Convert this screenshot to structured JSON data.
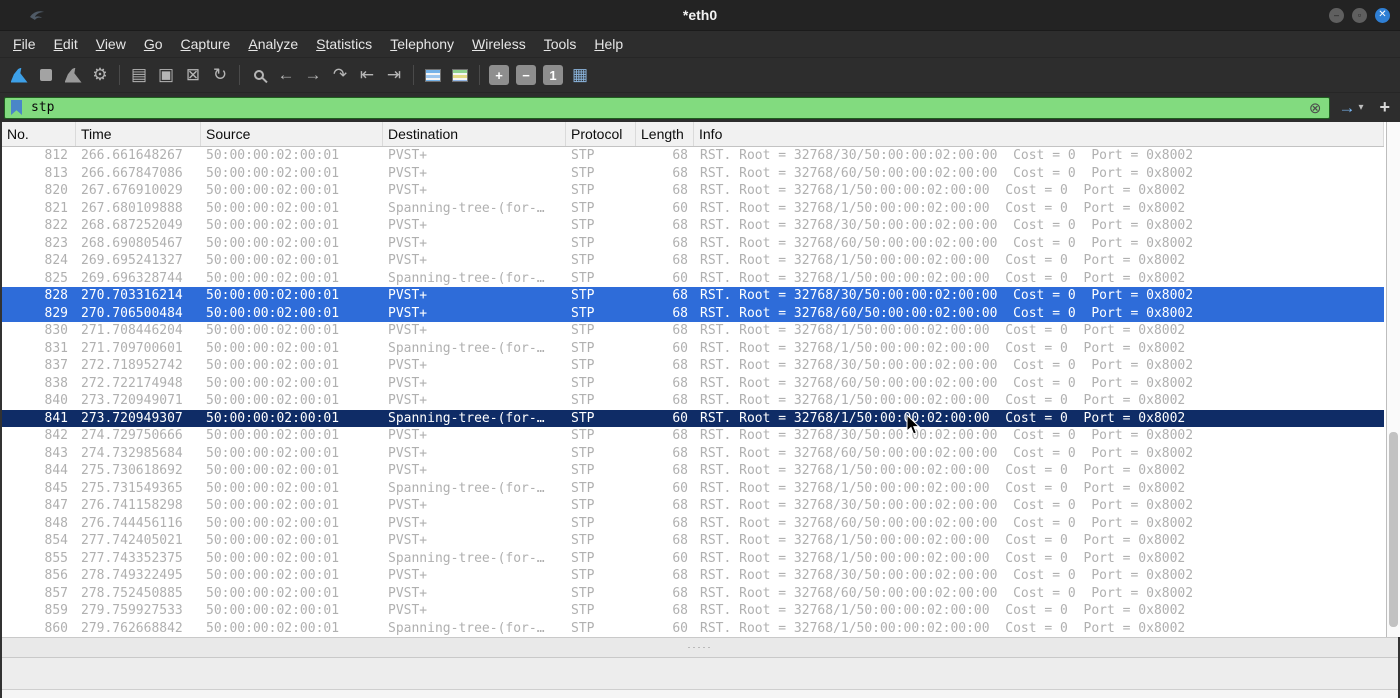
{
  "window": {
    "title": "*eth0",
    "controls": {
      "minimize": "–",
      "maximize": "▫",
      "close": "✕"
    }
  },
  "menu": {
    "items": [
      "File",
      "Edit",
      "View",
      "Go",
      "Capture",
      "Analyze",
      "Statistics",
      "Telephony",
      "Wireless",
      "Tools",
      "Help"
    ]
  },
  "toolbar": {
    "groups": [
      [
        {
          "name": "start-capture-icon",
          "shape": "fin",
          "color": "#3da0e8"
        },
        {
          "name": "stop-capture-icon",
          "shape": "square",
          "color": "#a3a3a3"
        },
        {
          "name": "restart-capture-icon",
          "shape": "fin",
          "color": "#9a9a9a"
        },
        {
          "name": "capture-options-icon",
          "glyph": "⚙"
        }
      ],
      [
        {
          "name": "open-file-icon",
          "glyph": "▤"
        },
        {
          "name": "save-file-icon",
          "glyph": "▣"
        },
        {
          "name": "close-file-icon",
          "glyph": "⊠"
        },
        {
          "name": "reload-file-icon",
          "glyph": "↻"
        }
      ],
      [
        {
          "name": "find-packet-icon",
          "shape": "search"
        },
        {
          "name": "go-back-icon",
          "glyph": "←"
        },
        {
          "name": "go-forward-icon",
          "glyph": "→"
        },
        {
          "name": "go-to-packet-icon",
          "glyph": "↷"
        },
        {
          "name": "go-first-icon",
          "glyph": "⇤"
        },
        {
          "name": "go-last-icon",
          "glyph": "⇥"
        }
      ],
      [
        {
          "name": "auto-scroll-icon",
          "shape": "stripes-blue"
        },
        {
          "name": "colorize-icon",
          "shape": "stripes-color"
        }
      ],
      [
        {
          "name": "zoom-in-icon",
          "glyph": "+",
          "box": true
        },
        {
          "name": "zoom-out-icon",
          "glyph": "−",
          "box": true
        },
        {
          "name": "zoom-original-icon",
          "glyph": "1",
          "box": true
        },
        {
          "name": "resize-columns-icon",
          "glyph": "▦",
          "color": "#8ab4dc"
        }
      ]
    ]
  },
  "filter": {
    "value": "stp",
    "clear_glyph": "⊗",
    "apply_glyph": "→",
    "dropdown_glyph": "▾",
    "add_button": "+"
  },
  "splitter_dots": "·····",
  "packet_list": {
    "columns": [
      "No.",
      "Time",
      "Source",
      "Destination",
      "Protocol",
      "Length",
      "Info"
    ],
    "rows": [
      {
        "no": "812",
        "time": "266.661648267",
        "src": "50:00:00:02:00:01",
        "dst": "PVST+",
        "proto": "STP",
        "len": "68",
        "info": "RST. Root = 32768/30/50:00:00:02:00:00  Cost = 0  Port = 0x8002",
        "state": "normal"
      },
      {
        "no": "813",
        "time": "266.667847086",
        "src": "50:00:00:02:00:01",
        "dst": "PVST+",
        "proto": "STP",
        "len": "68",
        "info": "RST. Root = 32768/60/50:00:00:02:00:00  Cost = 0  Port = 0x8002",
        "state": "normal"
      },
      {
        "no": "820",
        "time": "267.676910029",
        "src": "50:00:00:02:00:01",
        "dst": "PVST+",
        "proto": "STP",
        "len": "68",
        "info": "RST. Root = 32768/1/50:00:00:02:00:00  Cost = 0  Port = 0x8002",
        "state": "normal"
      },
      {
        "no": "821",
        "time": "267.680109888",
        "src": "50:00:00:02:00:01",
        "dst": "Spanning-tree-(for-…",
        "proto": "STP",
        "len": "60",
        "info": "RST. Root = 32768/1/50:00:00:02:00:00  Cost = 0  Port = 0x8002",
        "state": "normal"
      },
      {
        "no": "822",
        "time": "268.687252049",
        "src": "50:00:00:02:00:01",
        "dst": "PVST+",
        "proto": "STP",
        "len": "68",
        "info": "RST. Root = 32768/30/50:00:00:02:00:00  Cost = 0  Port = 0x8002",
        "state": "normal"
      },
      {
        "no": "823",
        "time": "268.690805467",
        "src": "50:00:00:02:00:01",
        "dst": "PVST+",
        "proto": "STP",
        "len": "68",
        "info": "RST. Root = 32768/60/50:00:00:02:00:00  Cost = 0  Port = 0x8002",
        "state": "normal"
      },
      {
        "no": "824",
        "time": "269.695241327",
        "src": "50:00:00:02:00:01",
        "dst": "PVST+",
        "proto": "STP",
        "len": "68",
        "info": "RST. Root = 32768/1/50:00:00:02:00:00  Cost = 0  Port = 0x8002",
        "state": "normal"
      },
      {
        "no": "825",
        "time": "269.696328744",
        "src": "50:00:00:02:00:01",
        "dst": "Spanning-tree-(for-…",
        "proto": "STP",
        "len": "60",
        "info": "RST. Root = 32768/1/50:00:00:02:00:00  Cost = 0  Port = 0x8002",
        "state": "normal"
      },
      {
        "no": "828",
        "time": "270.703316214",
        "src": "50:00:00:02:00:01",
        "dst": "PVST+",
        "proto": "STP",
        "len": "68",
        "info": "RST. Root = 32768/30/50:00:00:02:00:00  Cost = 0  Port = 0x8002",
        "state": "selected"
      },
      {
        "no": "829",
        "time": "270.706500484",
        "src": "50:00:00:02:00:01",
        "dst": "PVST+",
        "proto": "STP",
        "len": "68",
        "info": "RST. Root = 32768/60/50:00:00:02:00:00  Cost = 0  Port = 0x8002",
        "state": "selected"
      },
      {
        "no": "830",
        "time": "271.708446204",
        "src": "50:00:00:02:00:01",
        "dst": "PVST+",
        "proto": "STP",
        "len": "68",
        "info": "RST. Root = 32768/1/50:00:00:02:00:00  Cost = 0  Port = 0x8002",
        "state": "normal"
      },
      {
        "no": "831",
        "time": "271.709700601",
        "src": "50:00:00:02:00:01",
        "dst": "Spanning-tree-(for-…",
        "proto": "STP",
        "len": "60",
        "info": "RST. Root = 32768/1/50:00:00:02:00:00  Cost = 0  Port = 0x8002",
        "state": "normal"
      },
      {
        "no": "837",
        "time": "272.718952742",
        "src": "50:00:00:02:00:01",
        "dst": "PVST+",
        "proto": "STP",
        "len": "68",
        "info": "RST. Root = 32768/30/50:00:00:02:00:00  Cost = 0  Port = 0x8002",
        "state": "normal"
      },
      {
        "no": "838",
        "time": "272.722174948",
        "src": "50:00:00:02:00:01",
        "dst": "PVST+",
        "proto": "STP",
        "len": "68",
        "info": "RST. Root = 32768/60/50:00:00:02:00:00  Cost = 0  Port = 0x8002",
        "state": "normal"
      },
      {
        "no": "840",
        "time": "273.720949071",
        "src": "50:00:00:02:00:01",
        "dst": "PVST+",
        "proto": "STP",
        "len": "68",
        "info": "RST. Root = 32768/1/50:00:00:02:00:00  Cost = 0  Port = 0x8002",
        "state": "normal"
      },
      {
        "no": "841",
        "time": "273.720949307",
        "src": "50:00:00:02:00:01",
        "dst": "Spanning-tree-(for-…",
        "proto": "STP",
        "len": "60",
        "info": "RST. Root = 32768/1/50:00:00:02:00:00  Cost = 0  Port = 0x8002",
        "state": "marked"
      },
      {
        "no": "842",
        "time": "274.729750666",
        "src": "50:00:00:02:00:01",
        "dst": "PVST+",
        "proto": "STP",
        "len": "68",
        "info": "RST. Root = 32768/30/50:00:00:02:00:00  Cost = 0  Port = 0x8002",
        "state": "normal"
      },
      {
        "no": "843",
        "time": "274.732985684",
        "src": "50:00:00:02:00:01",
        "dst": "PVST+",
        "proto": "STP",
        "len": "68",
        "info": "RST. Root = 32768/60/50:00:00:02:00:00  Cost = 0  Port = 0x8002",
        "state": "normal"
      },
      {
        "no": "844",
        "time": "275.730618692",
        "src": "50:00:00:02:00:01",
        "dst": "PVST+",
        "proto": "STP",
        "len": "68",
        "info": "RST. Root = 32768/1/50:00:00:02:00:00  Cost = 0  Port = 0x8002",
        "state": "normal"
      },
      {
        "no": "845",
        "time": "275.731549365",
        "src": "50:00:00:02:00:01",
        "dst": "Spanning-tree-(for-…",
        "proto": "STP",
        "len": "60",
        "info": "RST. Root = 32768/1/50:00:00:02:00:00  Cost = 0  Port = 0x8002",
        "state": "normal"
      },
      {
        "no": "847",
        "time": "276.741158298",
        "src": "50:00:00:02:00:01",
        "dst": "PVST+",
        "proto": "STP",
        "len": "68",
        "info": "RST. Root = 32768/30/50:00:00:02:00:00  Cost = 0  Port = 0x8002",
        "state": "normal"
      },
      {
        "no": "848",
        "time": "276.744456116",
        "src": "50:00:00:02:00:01",
        "dst": "PVST+",
        "proto": "STP",
        "len": "68",
        "info": "RST. Root = 32768/60/50:00:00:02:00:00  Cost = 0  Port = 0x8002",
        "state": "normal"
      },
      {
        "no": "854",
        "time": "277.742405021",
        "src": "50:00:00:02:00:01",
        "dst": "PVST+",
        "proto": "STP",
        "len": "68",
        "info": "RST. Root = 32768/1/50:00:00:02:00:00  Cost = 0  Port = 0x8002",
        "state": "normal"
      },
      {
        "no": "855",
        "time": "277.743352375",
        "src": "50:00:00:02:00:01",
        "dst": "Spanning-tree-(for-…",
        "proto": "STP",
        "len": "60",
        "info": "RST. Root = 32768/1/50:00:00:02:00:00  Cost = 0  Port = 0x8002",
        "state": "normal"
      },
      {
        "no": "856",
        "time": "278.749322495",
        "src": "50:00:00:02:00:01",
        "dst": "PVST+",
        "proto": "STP",
        "len": "68",
        "info": "RST. Root = 32768/30/50:00:00:02:00:00  Cost = 0  Port = 0x8002",
        "state": "normal"
      },
      {
        "no": "857",
        "time": "278.752450885",
        "src": "50:00:00:02:00:01",
        "dst": "PVST+",
        "proto": "STP",
        "len": "68",
        "info": "RST. Root = 32768/60/50:00:00:02:00:00  Cost = 0  Port = 0x8002",
        "state": "normal"
      },
      {
        "no": "859",
        "time": "279.759927533",
        "src": "50:00:00:02:00:01",
        "dst": "PVST+",
        "proto": "STP",
        "len": "68",
        "info": "RST. Root = 32768/1/50:00:00:02:00:00  Cost = 0  Port = 0x8002",
        "state": "normal"
      },
      {
        "no": "860",
        "time": "279.762668842",
        "src": "50:00:00:02:00:01",
        "dst": "Spanning-tree-(for-…",
        "proto": "STP",
        "len": "60",
        "info": "RST. Root = 32768/1/50:00:00:02:00:00  Cost = 0  Port = 0x8002",
        "state": "normal"
      }
    ]
  },
  "colors": {
    "titlebar_bg": "#232323",
    "chrome_bg": "#2d2d2d",
    "filter_valid_bg": "#82db7f",
    "accent_blue": "#3da0e8",
    "row_text": "#b0b0b0",
    "row_selected_bg": "#2e6cd9",
    "row_marked_bg": "#0f2c66",
    "close_button_bg": "#2f7fd4"
  }
}
